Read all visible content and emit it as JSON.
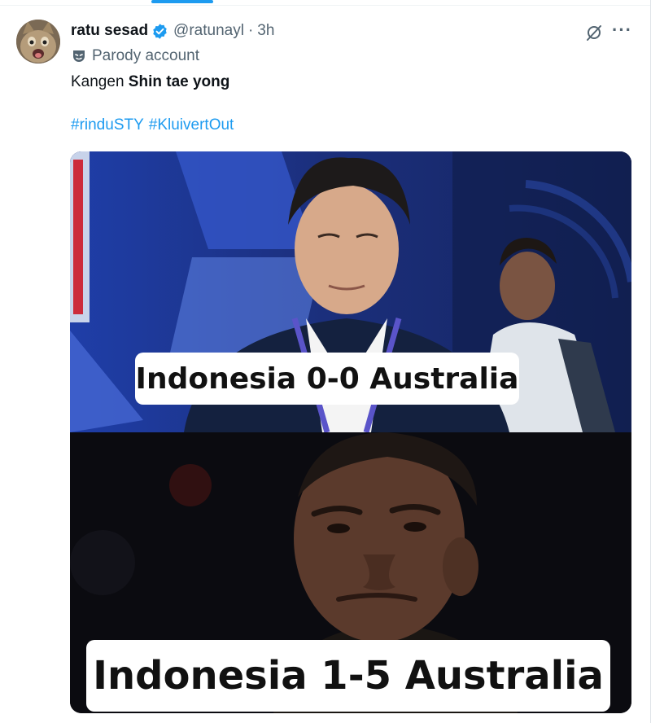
{
  "tweet": {
    "display_name": "ratu sesad",
    "handle": "@ratunayl",
    "separator": "·",
    "time": "3h",
    "parody_label": "Parody account",
    "text_prefix": "Kangen ",
    "text_bold": "Shin tae yong",
    "hashtags": [
      "#rinduSTY",
      "#KluivertOut"
    ]
  },
  "media": {
    "caption_top": "Indonesia 0-0 Australia",
    "caption_bottom": "Indonesia 1-5 Australia"
  },
  "icons": {
    "verified": "verified-badge-icon",
    "parody": "parody-mask-icon",
    "grok": "grok-icon",
    "more": "more-options-icon"
  },
  "colors": {
    "accent": "#1d9bf0",
    "secondary_text": "#536471",
    "primary_text": "#0f1419"
  }
}
